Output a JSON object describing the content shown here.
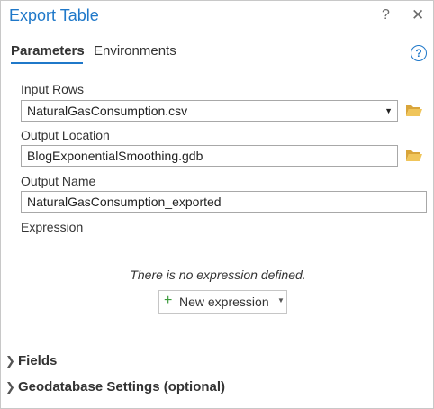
{
  "header": {
    "title": "Export Table",
    "help_symbol": "?",
    "close_symbol": "✕"
  },
  "tabs": [
    {
      "label": "Parameters",
      "active": true
    },
    {
      "label": "Environments",
      "active": false
    }
  ],
  "help_icon_symbol": "?",
  "params": {
    "input_rows": {
      "label": "Input Rows",
      "value": "NaturalGasConsumption.csv"
    },
    "output_location": {
      "label": "Output Location",
      "value": "BlogExponentialSmoothing.gdb"
    },
    "output_name": {
      "label": "Output Name",
      "value": "NaturalGasConsumption_exported"
    },
    "expression": {
      "label": "Expression",
      "empty_text": "There is no expression defined.",
      "new_button": "New expression"
    }
  },
  "sections": [
    {
      "label": "Fields"
    },
    {
      "label": "Geodatabase Settings (optional)"
    }
  ],
  "colors": {
    "accent": "#1f78c9",
    "folder": "#e8b84a",
    "plus": "#3a9a3a"
  },
  "icons": [
    "help-icon",
    "close-icon",
    "folder-open-icon",
    "dropdown-arrow-icon",
    "plus-icon",
    "chevron-right-icon"
  ]
}
